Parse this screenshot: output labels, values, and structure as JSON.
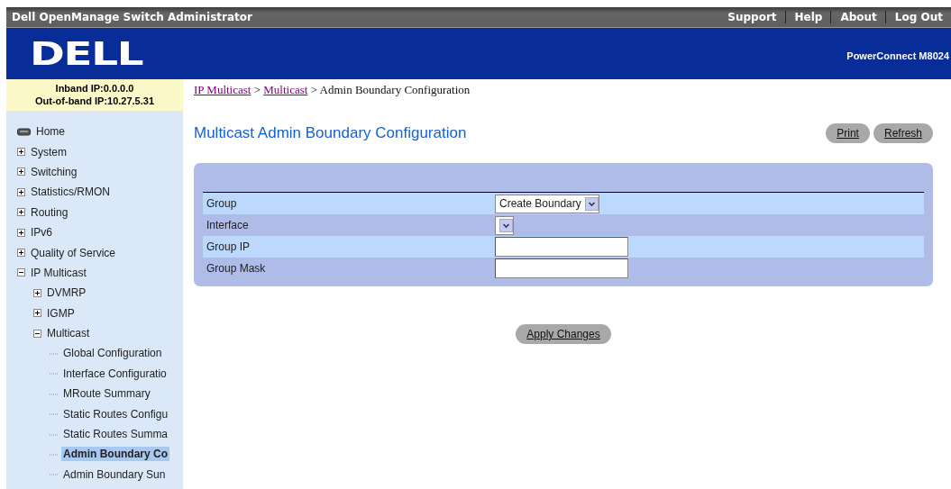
{
  "top_bar": {
    "title": "Dell OpenManage Switch Administrator",
    "links": [
      "Support",
      "Help",
      "About",
      "Log Out"
    ]
  },
  "header": {
    "logo": "DELL",
    "product": "PowerConnect M8024"
  },
  "sidebar": {
    "info": [
      "Inband IP:0.0.0.0",
      "Out-of-band IP:10.27.5.31"
    ],
    "tree": [
      {
        "label": "Home",
        "kind": "home",
        "selected": false
      },
      {
        "label": "System",
        "kind": "folder",
        "expanded": false,
        "selected": false
      },
      {
        "label": "Switching",
        "kind": "folder",
        "expanded": false,
        "selected": false
      },
      {
        "label": "Statistics/RMON",
        "kind": "folder",
        "expanded": false,
        "selected": false
      },
      {
        "label": "Routing",
        "kind": "folder",
        "expanded": false,
        "selected": false
      },
      {
        "label": "IPv6",
        "kind": "folder",
        "expanded": false,
        "selected": false
      },
      {
        "label": "Quality of Service",
        "kind": "folder",
        "expanded": false,
        "selected": false
      },
      {
        "label": "IP Multicast",
        "kind": "folder",
        "expanded": true,
        "selected": false,
        "children": [
          {
            "label": "DVMRP",
            "kind": "folder",
            "expanded": false,
            "selected": false
          },
          {
            "label": "IGMP",
            "kind": "folder",
            "expanded": false,
            "selected": false
          },
          {
            "label": "Multicast",
            "kind": "folder",
            "expanded": true,
            "selected": false,
            "children": [
              {
                "label": "Global Configuration",
                "kind": "leaf",
                "selected": false
              },
              {
                "label": "Interface Configuratio",
                "kind": "leaf",
                "selected": false
              },
              {
                "label": "MRoute Summary",
                "kind": "leaf",
                "selected": false
              },
              {
                "label": "Static Routes Configu",
                "kind": "leaf",
                "selected": false
              },
              {
                "label": "Static Routes Summa",
                "kind": "leaf",
                "selected": false
              },
              {
                "label": "Admin Boundary Co",
                "kind": "leaf",
                "selected": true
              },
              {
                "label": "Admin Boundary Sun",
                "kind": "leaf",
                "selected": false
              }
            ]
          }
        ]
      }
    ]
  },
  "breadcrumb": {
    "links": [
      "IP Multicast",
      "Multicast"
    ],
    "separators": [
      ">",
      ">"
    ],
    "current": "Admin Boundary Configuration"
  },
  "page": {
    "title": "Multicast Admin Boundary Configuration",
    "buttons": [
      "Print",
      "Refresh"
    ]
  },
  "form": {
    "rows": [
      {
        "label": "Group",
        "kind": "select",
        "value": "Create Boundary"
      },
      {
        "label": "Interface",
        "kind": "select"
      },
      {
        "label": "Group IP",
        "kind": "input"
      },
      {
        "label": "Group Mask",
        "kind": "input"
      }
    ]
  },
  "apply_button": "Apply Changes"
}
